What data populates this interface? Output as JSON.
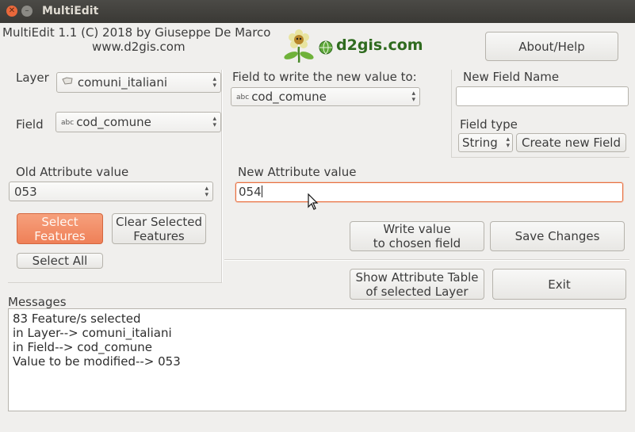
{
  "window": {
    "title": "MultiEdit"
  },
  "header": {
    "credit_line1": "MultiEdit 1.1  (C) 2018 by Giuseppe De Marco",
    "credit_line2": "www.d2gis.com",
    "logo_text": "d2gis.com"
  },
  "buttons": {
    "about_help": "About/Help",
    "select_features": [
      "Select",
      "Features"
    ],
    "clear_selected": [
      "Clear Selected",
      "Features"
    ],
    "select_all": "Select All",
    "write_value": [
      "Write value",
      "to chosen field"
    ],
    "save_changes": "Save Changes",
    "show_attr_table": [
      "Show Attribute Table",
      "of selected Layer"
    ],
    "exit": "Exit",
    "create_new_field": "Create new Field"
  },
  "left_panel": {
    "layer_label": "Layer",
    "layer_value": "comuni_italiani",
    "field_label": "Field",
    "field_value": "cod_comune",
    "old_attr_label": "Old Attribute value",
    "old_attr_value": "053"
  },
  "middle": {
    "write_field_label": "Field to write the new value to:",
    "write_field_value": "cod_comune",
    "new_attr_label": "New Attribute value",
    "new_attr_value": "054"
  },
  "right_panel": {
    "new_field_name_label": "New Field Name",
    "new_field_name_value": "",
    "field_type_label": "Field type",
    "field_type_value": "String"
  },
  "messages": {
    "label": "Messages",
    "lines": [
      "83 Feature/s selected",
      "in Layer--> comuni_italiani",
      "in Field--> cod_comune",
      "Value to be modified--> 053"
    ]
  },
  "colors": {
    "accent": "#ef8058",
    "titlebar": "#3f3e3a",
    "background": "#f0efed"
  },
  "icons": {
    "field_type_icon": "abc",
    "layer_icon": "polygon-layer-icon"
  }
}
